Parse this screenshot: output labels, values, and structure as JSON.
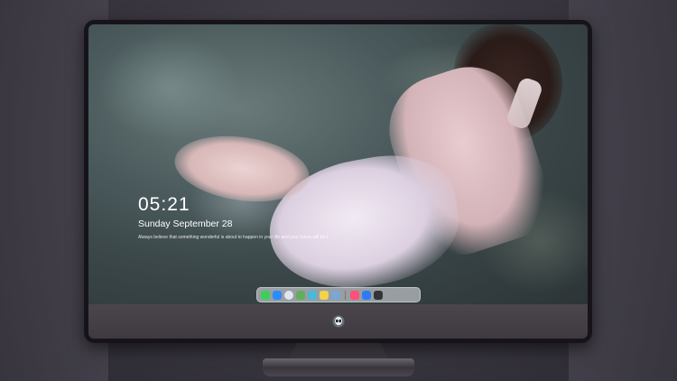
{
  "lockscreen": {
    "time": "05:21",
    "date": "Sunday September  28",
    "quote": "Always believe that something wonderful is about to happen in your life and your future will be bright · 愿你所愿"
  },
  "dock": {
    "apps": [
      {
        "name": "messages",
        "color": "#3ecf5a"
      },
      {
        "name": "finder",
        "color": "#2a8cff"
      },
      {
        "name": "safari",
        "color": "#dfe6f0"
      },
      {
        "name": "maps",
        "color": "#5fb05a"
      },
      {
        "name": "claquette",
        "color": "#4ab8d8"
      },
      {
        "name": "notes",
        "color": "#f4d24a"
      },
      {
        "name": "preview",
        "color": "#7aa6d8"
      },
      {
        "name": "music",
        "color": "#ff4f7a"
      },
      {
        "name": "app-store",
        "color": "#2d7cf6"
      },
      {
        "name": "camera",
        "color": "#333338"
      }
    ]
  }
}
